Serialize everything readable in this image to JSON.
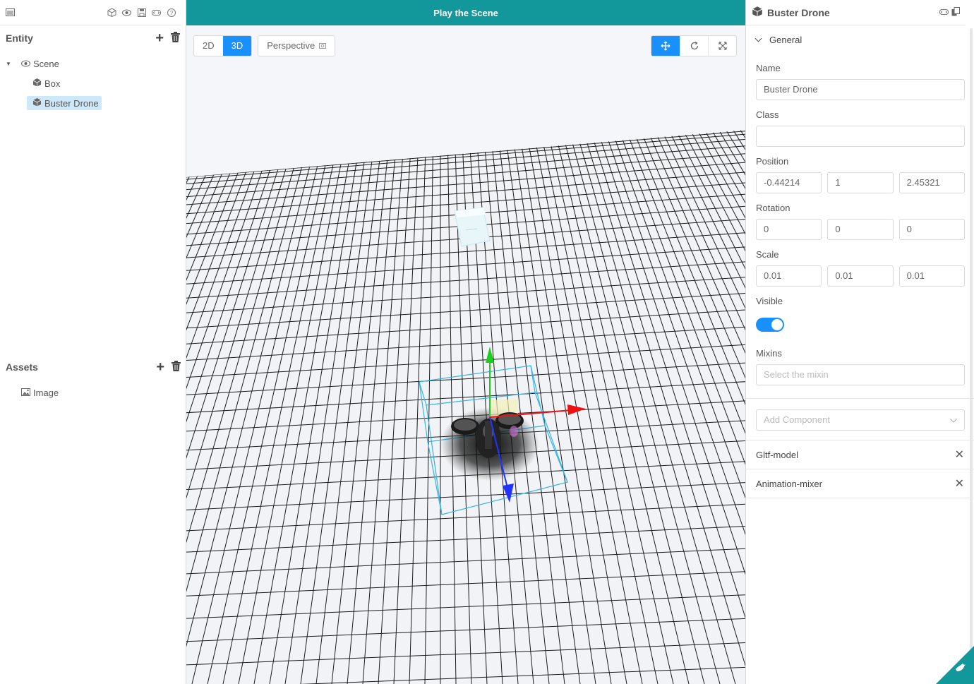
{
  "left": {
    "toolbar_icons": [
      "menu-icon",
      "cube-icon",
      "eye-icon",
      "save-icon",
      "dev-icon",
      "help-icon"
    ],
    "entity": {
      "title": "Entity",
      "tree": {
        "scene": "Scene",
        "box": "Box",
        "buster_drone": "Buster Drone"
      }
    },
    "assets": {
      "title": "Assets",
      "items": {
        "image": "Image"
      }
    }
  },
  "center": {
    "play_label": "Play the Scene",
    "view_2d": "2D",
    "view_3d": "3D",
    "camera": "Perspective"
  },
  "right": {
    "entity_title": "Buster Drone",
    "general_label": "General",
    "name_label": "Name",
    "name_value": "Buster Drone",
    "class_label": "Class",
    "class_value": "",
    "position_label": "Position",
    "position": [
      "-0.44214",
      "1",
      "2.45321"
    ],
    "rotation_label": "Rotation",
    "rotation": [
      "0",
      "0",
      "0"
    ],
    "scale_label": "Scale",
    "scale": [
      "0.01",
      "0.01",
      "0.01"
    ],
    "visible_label": "Visible",
    "visible": true,
    "mixins_label": "Mixins",
    "mixins_placeholder": "Select the mixin",
    "add_component_placeholder": "Add Component",
    "components": {
      "gltf": "Gltf-model",
      "animation": "Animation-mixer"
    }
  },
  "colors": {
    "accent": "#12979b",
    "primary": "#1890ff",
    "selection": "#cde9f9"
  }
}
